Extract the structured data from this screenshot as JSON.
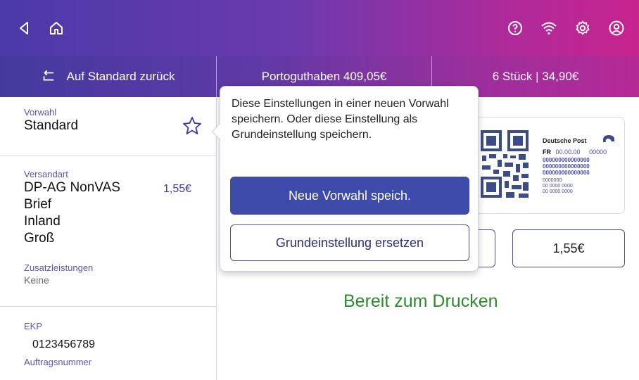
{
  "topbar": {
    "icons": [
      "back-icon",
      "home-icon",
      "help-icon",
      "wifi-icon",
      "settings-icon",
      "account-icon"
    ]
  },
  "subbar": {
    "reset_label": "Auf Standard zurück",
    "postage_credit": "Portoguthaben 409,05€",
    "count_total": "6 Stück | 34,90€"
  },
  "preset": {
    "label": "Vorwahl",
    "value": "Standard"
  },
  "shipping": {
    "label": "Versandart",
    "product": "DP-AG NonVAS",
    "price": "1,55€",
    "type": "Brief",
    "region": "Inland",
    "size": "Groß",
    "extras_label": "Zusatzleistungen",
    "extras_value": "Keine"
  },
  "ekp": {
    "label": "EKP",
    "value": "0123456789",
    "order_label": "Auftragsnummer"
  },
  "stamp": {
    "brand": "Deutsche Post",
    "country": "FR",
    "date": "00.00.00",
    "code": "00000",
    "line1": "000000000000000",
    "line2": "000000000000000",
    "line3": "000000000000000",
    "small1": "0000000",
    "small2": "00 0000 0000",
    "small3": "00 0000 0000"
  },
  "postage_value": "1,55€",
  "status": "Bereit zum Drucken",
  "popover": {
    "message": "Diese Einstellungen in einer neuen Vorwahl speichern. Oder diese Einstellung als Grundeinstellung speichern.",
    "primary_label": "Neue Vorwahl speich.",
    "secondary_label": "Grundeinstellung ersetzen"
  },
  "colors": {
    "accent": "#3f4bab",
    "status_green": "#2e8a2e"
  }
}
